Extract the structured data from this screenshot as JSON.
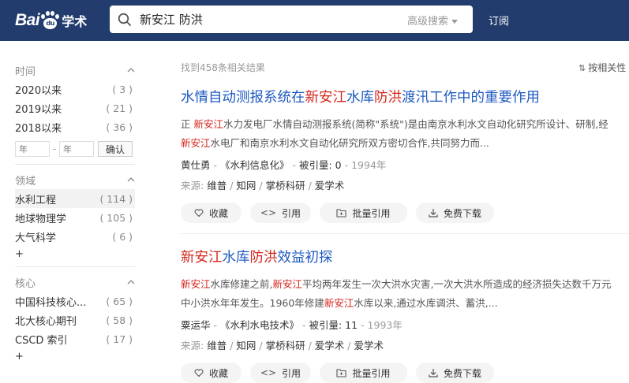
{
  "header": {
    "logo_text": "Bai",
    "logo_du": "du",
    "logo_suffix": "学术",
    "search_value": "新安江 防洪",
    "advanced_search": "高级搜索",
    "subscribe": "订阅",
    "bg_color": "#223c6d"
  },
  "sidebar": {
    "time": {
      "title": "时间",
      "items": [
        {
          "label": "2020以来",
          "count": "( 3 )"
        },
        {
          "label": "2019以来",
          "count": "( 21 )"
        },
        {
          "label": "2018以来",
          "count": "( 36 )"
        }
      ],
      "year_placeholder_from": "年",
      "year_placeholder_to": "年",
      "dash": "-",
      "confirm": "确认"
    },
    "field": {
      "title": "领域",
      "items": [
        {
          "label": "水利工程",
          "count": "( 114 )"
        },
        {
          "label": "地球物理学",
          "count": "( 105 )"
        },
        {
          "label": "大气科学",
          "count": "( 6 )"
        }
      ],
      "more": "+"
    },
    "core": {
      "title": "核心",
      "items": [
        {
          "label": "中国科技核心...",
          "count": "( 65 )"
        },
        {
          "label": "北大核心期刊",
          "count": "( 58 )"
        },
        {
          "label": "CSCD 索引",
          "count": "( 17 )"
        }
      ],
      "more": "+"
    }
  },
  "results_header": {
    "count_text": "找到458条相关结果",
    "sort_label": "按相关性"
  },
  "results": [
    {
      "title_parts": [
        "水情自动测报系统在",
        "新安江",
        "水库",
        "防洪",
        "渡汛工作中的重要作用"
      ],
      "abstract_line1_parts": [
        "正 ",
        "新安江",
        "水力发电厂水情自动测报系统(简称\"系统\")是由南京水利水文自动化研究所设计、研制,经"
      ],
      "abstract_line2_parts": [
        "新安江",
        "水电厂和南京水利水文自动化研究所双方密切合作,共同努力而..."
      ],
      "author": "黄仕勇",
      "journal": "《水利信息化》",
      "cited_label": "被引量:",
      "cited": "0",
      "year": "1994年",
      "source_label": "来源:",
      "sources": [
        "维普",
        "知网",
        "掌桥科研",
        "爱学术"
      ]
    },
    {
      "title_parts": [
        "新安江",
        "水库",
        "防洪",
        "效益初探"
      ],
      "abstract_line1_parts": [
        "新安江",
        "水库修建之前,",
        "新安江",
        "平均两年发生一次大洪水灾害,一次大洪水所造成的经济损失达数千万元"
      ],
      "abstract_line2_parts": [
        "中小洪水年年发生。1960年修建",
        "新安江",
        "水库以来,通过水库调洪、蓄洪,..."
      ],
      "author": "粟运华",
      "journal": "《水利水电技术》",
      "cited_label": "被引量:",
      "cited": "11",
      "year": "1993年",
      "source_label": "来源:",
      "sources": [
        "维普",
        "知网",
        "掌桥科研",
        "爱学术",
        "爱学术"
      ]
    }
  ],
  "actions": {
    "collect": "收藏",
    "cite": "引用",
    "batch_cite": "批量引用",
    "free_download": "免费下载"
  },
  "colors": {
    "title_link": "#1f5ac0",
    "highlight": "#d4251c"
  }
}
